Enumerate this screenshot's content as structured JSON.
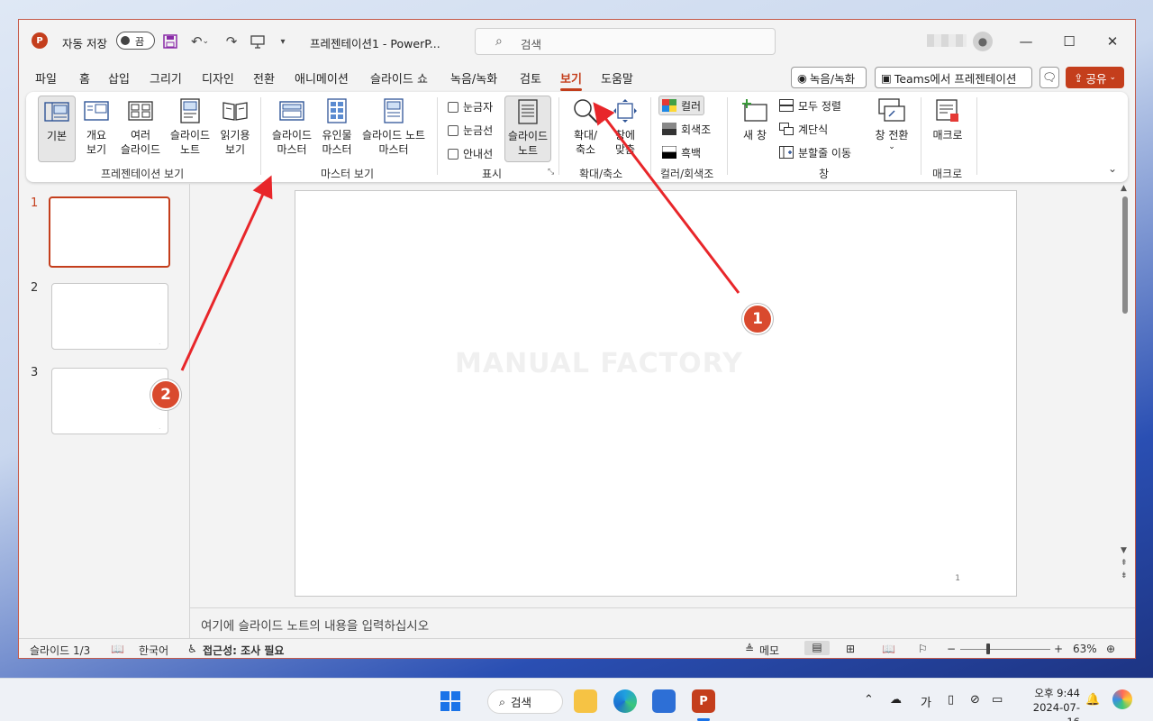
{
  "titlebar": {
    "app_logo": "P",
    "autosave_label": "자동 저장",
    "autosave_state": "끔",
    "doc_title": "프레젠테이션1  -  PowerP...",
    "search_placeholder": "검색"
  },
  "tabs": [
    "파일",
    "홈",
    "삽입",
    "그리기",
    "디자인",
    "전환",
    "애니메이션",
    "슬라이드 쇼",
    "녹음/녹화",
    "검토",
    "보기",
    "도움말"
  ],
  "active_tab": "보기",
  "right_actions": {
    "record": "녹음/녹화",
    "teams": "Teams에서 프레젠테이션",
    "share": "공유"
  },
  "ribbon": {
    "presentation_views": {
      "label": "프레젠테이션 보기",
      "buttons": [
        {
          "l1": "기본",
          "l2": ""
        },
        {
          "l1": "개요",
          "l2": "보기"
        },
        {
          "l1": "여러",
          "l2": "슬라이드"
        },
        {
          "l1": "슬라이드",
          "l2": "노트"
        },
        {
          "l1": "읽기용",
          "l2": "보기"
        }
      ]
    },
    "master_views": {
      "label": "마스터 보기",
      "buttons": [
        {
          "l1": "슬라이드",
          "l2": "마스터"
        },
        {
          "l1": "유인물",
          "l2": "마스터"
        },
        {
          "l1": "슬라이드 노트",
          "l2": "마스터"
        }
      ]
    },
    "show": {
      "label": "표시",
      "checks": [
        "눈금자",
        "눈금선",
        "안내선"
      ],
      "notes_btn": {
        "l1": "슬라이드",
        "l2": "노트"
      }
    },
    "zoom": {
      "label": "확대/축소",
      "buttons": [
        {
          "l1": "확대/",
          "l2": "축소"
        },
        {
          "l1": "창에",
          "l2": "맞춤"
        }
      ]
    },
    "color": {
      "label": "컬러/회색조",
      "buttons": [
        "컬러",
        "회색조",
        "흑백"
      ]
    },
    "window": {
      "label": "창",
      "new_window": "새 창",
      "small": [
        "모두 정렬",
        "계단식",
        "분할줄 이동"
      ],
      "switch": "창 전환"
    },
    "macro": {
      "label": "매크로",
      "button": "매크로"
    }
  },
  "slides": {
    "numbers": [
      "1",
      "2",
      "3"
    ],
    "selected": 1
  },
  "slide": {
    "watermark": "MANUAL FACTORY",
    "page_number": "1"
  },
  "notes_placeholder": "여기에 슬라이드 노트의 내용을 입력하십시오",
  "status": {
    "slide_count": "슬라이드 1/3",
    "language": "한국어",
    "accessibility": "접근성: 조사 필요",
    "memo": "메모",
    "zoom_percent": "63%",
    "zoom_fraction": 0.3
  },
  "annotations": [
    "1",
    "2"
  ],
  "taskbar": {
    "search": "검색",
    "ime": "가",
    "clock_time": "오후 9:44",
    "clock_date": "2024-07-16"
  },
  "colors": {
    "accent": "#c43e1c",
    "badge": "#d94a2e",
    "arrow": "#e8262a"
  }
}
